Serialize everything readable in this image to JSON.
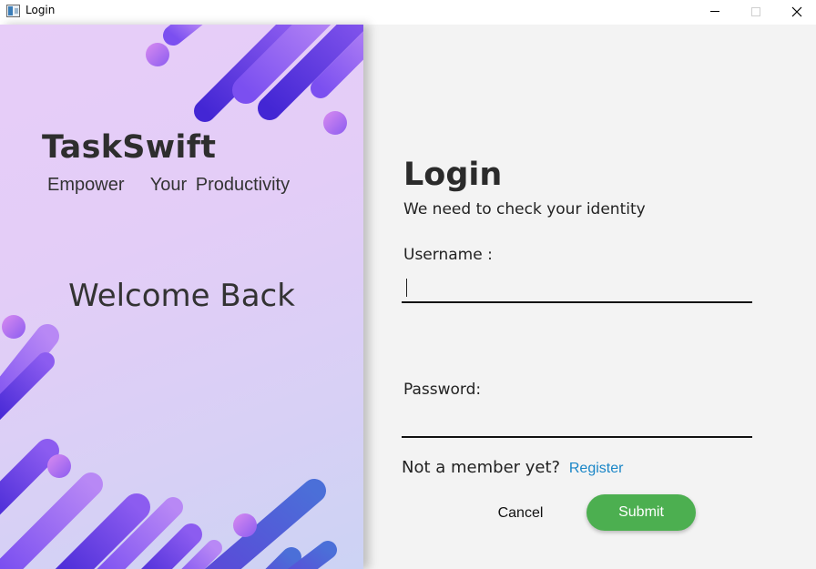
{
  "window": {
    "title": "Login",
    "icon": "app-window-icon",
    "controls": [
      "minimize-icon",
      "maximize-icon",
      "close-icon"
    ]
  },
  "left_panel": {
    "brand": "TaskSwift",
    "tagline": "Empower   Your Productivity",
    "welcome": "Welcome Back",
    "colors": {
      "gradient_top": "#e7cdf8",
      "gradient_bottom": "#ccd3f4",
      "shape_dark": "#4b2fd6",
      "shape_light": "#b27cf0"
    }
  },
  "login_form": {
    "title": "Login",
    "subtitle": "We need to check your identity",
    "username_label": "Username :",
    "username_value": "",
    "password_label": "Password:",
    "password_value": "",
    "member_prompt": "Not a member yet?",
    "register_link": "Register",
    "cancel_label": "Cancel",
    "submit_label": "Submit",
    "colors": {
      "submit": "#4caf50",
      "link": "#1a86c7",
      "background": "#f3f3f3"
    }
  }
}
